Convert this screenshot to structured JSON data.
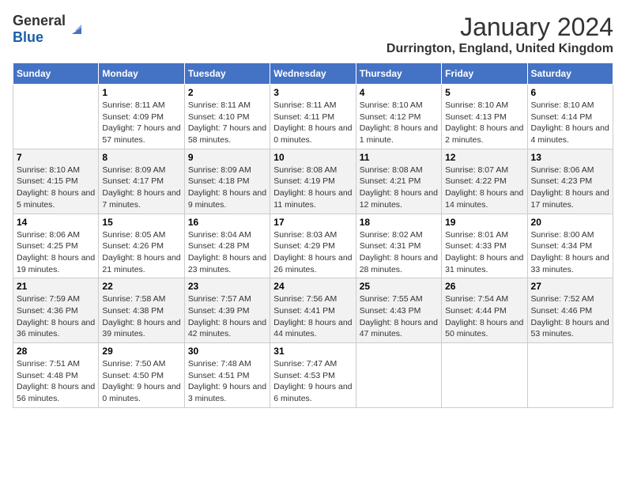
{
  "header": {
    "logo_general": "General",
    "logo_blue": "Blue",
    "title": "January 2024",
    "subtitle": "Durrington, England, United Kingdom"
  },
  "calendar": {
    "days_of_week": [
      "Sunday",
      "Monday",
      "Tuesday",
      "Wednesday",
      "Thursday",
      "Friday",
      "Saturday"
    ],
    "weeks": [
      [
        {
          "day": "",
          "sunrise": "",
          "sunset": "",
          "daylight": ""
        },
        {
          "day": "1",
          "sunrise": "Sunrise: 8:11 AM",
          "sunset": "Sunset: 4:09 PM",
          "daylight": "Daylight: 7 hours and 57 minutes."
        },
        {
          "day": "2",
          "sunrise": "Sunrise: 8:11 AM",
          "sunset": "Sunset: 4:10 PM",
          "daylight": "Daylight: 7 hours and 58 minutes."
        },
        {
          "day": "3",
          "sunrise": "Sunrise: 8:11 AM",
          "sunset": "Sunset: 4:11 PM",
          "daylight": "Daylight: 8 hours and 0 minutes."
        },
        {
          "day": "4",
          "sunrise": "Sunrise: 8:10 AM",
          "sunset": "Sunset: 4:12 PM",
          "daylight": "Daylight: 8 hours and 1 minute."
        },
        {
          "day": "5",
          "sunrise": "Sunrise: 8:10 AM",
          "sunset": "Sunset: 4:13 PM",
          "daylight": "Daylight: 8 hours and 2 minutes."
        },
        {
          "day": "6",
          "sunrise": "Sunrise: 8:10 AM",
          "sunset": "Sunset: 4:14 PM",
          "daylight": "Daylight: 8 hours and 4 minutes."
        }
      ],
      [
        {
          "day": "7",
          "sunrise": "Sunrise: 8:10 AM",
          "sunset": "Sunset: 4:15 PM",
          "daylight": "Daylight: 8 hours and 5 minutes."
        },
        {
          "day": "8",
          "sunrise": "Sunrise: 8:09 AM",
          "sunset": "Sunset: 4:17 PM",
          "daylight": "Daylight: 8 hours and 7 minutes."
        },
        {
          "day": "9",
          "sunrise": "Sunrise: 8:09 AM",
          "sunset": "Sunset: 4:18 PM",
          "daylight": "Daylight: 8 hours and 9 minutes."
        },
        {
          "day": "10",
          "sunrise": "Sunrise: 8:08 AM",
          "sunset": "Sunset: 4:19 PM",
          "daylight": "Daylight: 8 hours and 11 minutes."
        },
        {
          "day": "11",
          "sunrise": "Sunrise: 8:08 AM",
          "sunset": "Sunset: 4:21 PM",
          "daylight": "Daylight: 8 hours and 12 minutes."
        },
        {
          "day": "12",
          "sunrise": "Sunrise: 8:07 AM",
          "sunset": "Sunset: 4:22 PM",
          "daylight": "Daylight: 8 hours and 14 minutes."
        },
        {
          "day": "13",
          "sunrise": "Sunrise: 8:06 AM",
          "sunset": "Sunset: 4:23 PM",
          "daylight": "Daylight: 8 hours and 17 minutes."
        }
      ],
      [
        {
          "day": "14",
          "sunrise": "Sunrise: 8:06 AM",
          "sunset": "Sunset: 4:25 PM",
          "daylight": "Daylight: 8 hours and 19 minutes."
        },
        {
          "day": "15",
          "sunrise": "Sunrise: 8:05 AM",
          "sunset": "Sunset: 4:26 PM",
          "daylight": "Daylight: 8 hours and 21 minutes."
        },
        {
          "day": "16",
          "sunrise": "Sunrise: 8:04 AM",
          "sunset": "Sunset: 4:28 PM",
          "daylight": "Daylight: 8 hours and 23 minutes."
        },
        {
          "day": "17",
          "sunrise": "Sunrise: 8:03 AM",
          "sunset": "Sunset: 4:29 PM",
          "daylight": "Daylight: 8 hours and 26 minutes."
        },
        {
          "day": "18",
          "sunrise": "Sunrise: 8:02 AM",
          "sunset": "Sunset: 4:31 PM",
          "daylight": "Daylight: 8 hours and 28 minutes."
        },
        {
          "day": "19",
          "sunrise": "Sunrise: 8:01 AM",
          "sunset": "Sunset: 4:33 PM",
          "daylight": "Daylight: 8 hours and 31 minutes."
        },
        {
          "day": "20",
          "sunrise": "Sunrise: 8:00 AM",
          "sunset": "Sunset: 4:34 PM",
          "daylight": "Daylight: 8 hours and 33 minutes."
        }
      ],
      [
        {
          "day": "21",
          "sunrise": "Sunrise: 7:59 AM",
          "sunset": "Sunset: 4:36 PM",
          "daylight": "Daylight: 8 hours and 36 minutes."
        },
        {
          "day": "22",
          "sunrise": "Sunrise: 7:58 AM",
          "sunset": "Sunset: 4:38 PM",
          "daylight": "Daylight: 8 hours and 39 minutes."
        },
        {
          "day": "23",
          "sunrise": "Sunrise: 7:57 AM",
          "sunset": "Sunset: 4:39 PM",
          "daylight": "Daylight: 8 hours and 42 minutes."
        },
        {
          "day": "24",
          "sunrise": "Sunrise: 7:56 AM",
          "sunset": "Sunset: 4:41 PM",
          "daylight": "Daylight: 8 hours and 44 minutes."
        },
        {
          "day": "25",
          "sunrise": "Sunrise: 7:55 AM",
          "sunset": "Sunset: 4:43 PM",
          "daylight": "Daylight: 8 hours and 47 minutes."
        },
        {
          "day": "26",
          "sunrise": "Sunrise: 7:54 AM",
          "sunset": "Sunset: 4:44 PM",
          "daylight": "Daylight: 8 hours and 50 minutes."
        },
        {
          "day": "27",
          "sunrise": "Sunrise: 7:52 AM",
          "sunset": "Sunset: 4:46 PM",
          "daylight": "Daylight: 8 hours and 53 minutes."
        }
      ],
      [
        {
          "day": "28",
          "sunrise": "Sunrise: 7:51 AM",
          "sunset": "Sunset: 4:48 PM",
          "daylight": "Daylight: 8 hours and 56 minutes."
        },
        {
          "day": "29",
          "sunrise": "Sunrise: 7:50 AM",
          "sunset": "Sunset: 4:50 PM",
          "daylight": "Daylight: 9 hours and 0 minutes."
        },
        {
          "day": "30",
          "sunrise": "Sunrise: 7:48 AM",
          "sunset": "Sunset: 4:51 PM",
          "daylight": "Daylight: 9 hours and 3 minutes."
        },
        {
          "day": "31",
          "sunrise": "Sunrise: 7:47 AM",
          "sunset": "Sunset: 4:53 PM",
          "daylight": "Daylight: 9 hours and 6 minutes."
        },
        {
          "day": "",
          "sunrise": "",
          "sunset": "",
          "daylight": ""
        },
        {
          "day": "",
          "sunrise": "",
          "sunset": "",
          "daylight": ""
        },
        {
          "day": "",
          "sunrise": "",
          "sunset": "",
          "daylight": ""
        }
      ]
    ]
  }
}
